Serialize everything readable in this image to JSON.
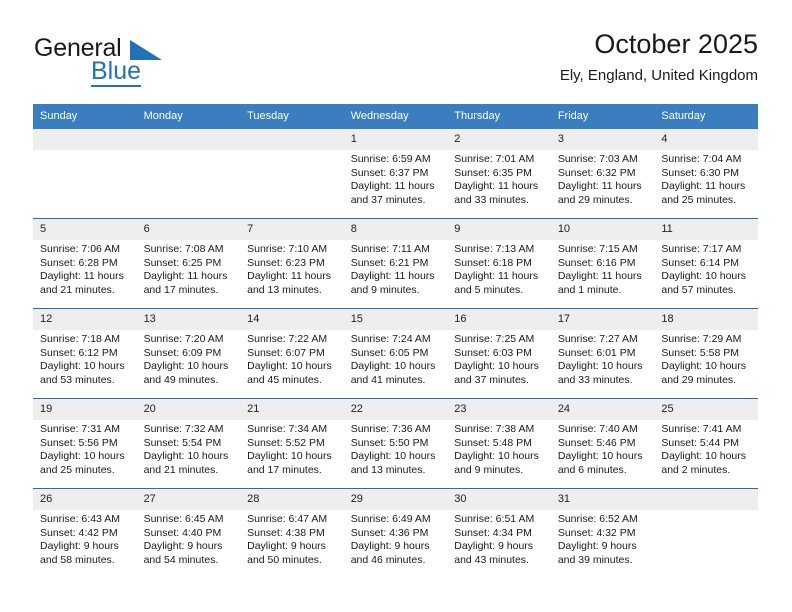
{
  "brand": {
    "line1": "General",
    "line2": "Blue",
    "triangle_icon": "blue-triangle-icon",
    "accent_color": "#2272b8"
  },
  "header": {
    "title": "October 2025",
    "subtitle": "Ely, England, United Kingdom"
  },
  "theme": {
    "header_row_bg": "#3a7ebf",
    "row_divider": "#2b6ca3",
    "daynum_bg": "#eeeeee"
  },
  "weekdays": [
    "Sunday",
    "Monday",
    "Tuesday",
    "Wednesday",
    "Thursday",
    "Friday",
    "Saturday"
  ],
  "labels": {
    "sunrise": "Sunrise:",
    "sunset": "Sunset:",
    "daylight": "Daylight:"
  },
  "weeks": [
    [
      {
        "day": ""
      },
      {
        "day": ""
      },
      {
        "day": ""
      },
      {
        "day": "1",
        "sunrise": "Sunrise: 6:59 AM",
        "sunset": "Sunset: 6:37 PM",
        "daylight": "Daylight: 11 hours and 37 minutes."
      },
      {
        "day": "2",
        "sunrise": "Sunrise: 7:01 AM",
        "sunset": "Sunset: 6:35 PM",
        "daylight": "Daylight: 11 hours and 33 minutes."
      },
      {
        "day": "3",
        "sunrise": "Sunrise: 7:03 AM",
        "sunset": "Sunset: 6:32 PM",
        "daylight": "Daylight: 11 hours and 29 minutes."
      },
      {
        "day": "4",
        "sunrise": "Sunrise: 7:04 AM",
        "sunset": "Sunset: 6:30 PM",
        "daylight": "Daylight: 11 hours and 25 minutes."
      }
    ],
    [
      {
        "day": "5",
        "sunrise": "Sunrise: 7:06 AM",
        "sunset": "Sunset: 6:28 PM",
        "daylight": "Daylight: 11 hours and 21 minutes."
      },
      {
        "day": "6",
        "sunrise": "Sunrise: 7:08 AM",
        "sunset": "Sunset: 6:25 PM",
        "daylight": "Daylight: 11 hours and 17 minutes."
      },
      {
        "day": "7",
        "sunrise": "Sunrise: 7:10 AM",
        "sunset": "Sunset: 6:23 PM",
        "daylight": "Daylight: 11 hours and 13 minutes."
      },
      {
        "day": "8",
        "sunrise": "Sunrise: 7:11 AM",
        "sunset": "Sunset: 6:21 PM",
        "daylight": "Daylight: 11 hours and 9 minutes."
      },
      {
        "day": "9",
        "sunrise": "Sunrise: 7:13 AM",
        "sunset": "Sunset: 6:18 PM",
        "daylight": "Daylight: 11 hours and 5 minutes."
      },
      {
        "day": "10",
        "sunrise": "Sunrise: 7:15 AM",
        "sunset": "Sunset: 6:16 PM",
        "daylight": "Daylight: 11 hours and 1 minute."
      },
      {
        "day": "11",
        "sunrise": "Sunrise: 7:17 AM",
        "sunset": "Sunset: 6:14 PM",
        "daylight": "Daylight: 10 hours and 57 minutes."
      }
    ],
    [
      {
        "day": "12",
        "sunrise": "Sunrise: 7:18 AM",
        "sunset": "Sunset: 6:12 PM",
        "daylight": "Daylight: 10 hours and 53 minutes."
      },
      {
        "day": "13",
        "sunrise": "Sunrise: 7:20 AM",
        "sunset": "Sunset: 6:09 PM",
        "daylight": "Daylight: 10 hours and 49 minutes."
      },
      {
        "day": "14",
        "sunrise": "Sunrise: 7:22 AM",
        "sunset": "Sunset: 6:07 PM",
        "daylight": "Daylight: 10 hours and 45 minutes."
      },
      {
        "day": "15",
        "sunrise": "Sunrise: 7:24 AM",
        "sunset": "Sunset: 6:05 PM",
        "daylight": "Daylight: 10 hours and 41 minutes."
      },
      {
        "day": "16",
        "sunrise": "Sunrise: 7:25 AM",
        "sunset": "Sunset: 6:03 PM",
        "daylight": "Daylight: 10 hours and 37 minutes."
      },
      {
        "day": "17",
        "sunrise": "Sunrise: 7:27 AM",
        "sunset": "Sunset: 6:01 PM",
        "daylight": "Daylight: 10 hours and 33 minutes."
      },
      {
        "day": "18",
        "sunrise": "Sunrise: 7:29 AM",
        "sunset": "Sunset: 5:58 PM",
        "daylight": "Daylight: 10 hours and 29 minutes."
      }
    ],
    [
      {
        "day": "19",
        "sunrise": "Sunrise: 7:31 AM",
        "sunset": "Sunset: 5:56 PM",
        "daylight": "Daylight: 10 hours and 25 minutes."
      },
      {
        "day": "20",
        "sunrise": "Sunrise: 7:32 AM",
        "sunset": "Sunset: 5:54 PM",
        "daylight": "Daylight: 10 hours and 21 minutes."
      },
      {
        "day": "21",
        "sunrise": "Sunrise: 7:34 AM",
        "sunset": "Sunset: 5:52 PM",
        "daylight": "Daylight: 10 hours and 17 minutes."
      },
      {
        "day": "22",
        "sunrise": "Sunrise: 7:36 AM",
        "sunset": "Sunset: 5:50 PM",
        "daylight": "Daylight: 10 hours and 13 minutes."
      },
      {
        "day": "23",
        "sunrise": "Sunrise: 7:38 AM",
        "sunset": "Sunset: 5:48 PM",
        "daylight": "Daylight: 10 hours and 9 minutes."
      },
      {
        "day": "24",
        "sunrise": "Sunrise: 7:40 AM",
        "sunset": "Sunset: 5:46 PM",
        "daylight": "Daylight: 10 hours and 6 minutes."
      },
      {
        "day": "25",
        "sunrise": "Sunrise: 7:41 AM",
        "sunset": "Sunset: 5:44 PM",
        "daylight": "Daylight: 10 hours and 2 minutes."
      }
    ],
    [
      {
        "day": "26",
        "sunrise": "Sunrise: 6:43 AM",
        "sunset": "Sunset: 4:42 PM",
        "daylight": "Daylight: 9 hours and 58 minutes."
      },
      {
        "day": "27",
        "sunrise": "Sunrise: 6:45 AM",
        "sunset": "Sunset: 4:40 PM",
        "daylight": "Daylight: 9 hours and 54 minutes."
      },
      {
        "day": "28",
        "sunrise": "Sunrise: 6:47 AM",
        "sunset": "Sunset: 4:38 PM",
        "daylight": "Daylight: 9 hours and 50 minutes."
      },
      {
        "day": "29",
        "sunrise": "Sunrise: 6:49 AM",
        "sunset": "Sunset: 4:36 PM",
        "daylight": "Daylight: 9 hours and 46 minutes."
      },
      {
        "day": "30",
        "sunrise": "Sunrise: 6:51 AM",
        "sunset": "Sunset: 4:34 PM",
        "daylight": "Daylight: 9 hours and 43 minutes."
      },
      {
        "day": "31",
        "sunrise": "Sunrise: 6:52 AM",
        "sunset": "Sunset: 4:32 PM",
        "daylight": "Daylight: 9 hours and 39 minutes."
      },
      {
        "day": ""
      }
    ]
  ]
}
